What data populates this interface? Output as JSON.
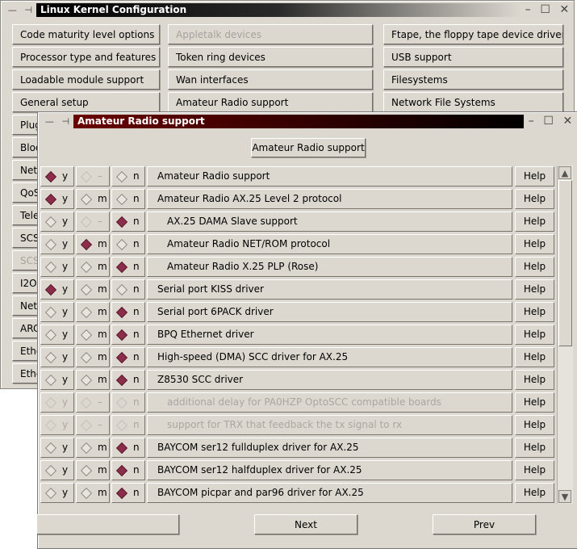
{
  "main_window": {
    "title": "Linux Kernel Configuration",
    "buttons_col1": [
      "Code maturity level options",
      "Processor type and features",
      "Loadable module support",
      "General setup",
      "Plug",
      "Bloc",
      "Netw",
      "QoS",
      "Tele",
      "SCS",
      "SCS",
      "I2O",
      "Netw",
      "ARC",
      "Ethe",
      "Ethe"
    ],
    "buttons_col2": [
      "Appletalk devices",
      "Token ring devices",
      "Wan interfaces",
      "Amateur Radio support"
    ],
    "buttons_col3": [
      "Ftape, the floppy tape device driver",
      "USB support",
      "Filesystems",
      "Network File Systems"
    ]
  },
  "child_window": {
    "title": "Amateur Radio support",
    "header_button": "Amateur Radio support",
    "option_labels": {
      "y": "y",
      "m": "m",
      "n": "n",
      "dash": "–"
    },
    "help_label": "Help",
    "rows": [
      {
        "label": "Amateur Radio support",
        "selected": "y",
        "m_dash": true,
        "indent": false,
        "disabled": false
      },
      {
        "label": "Amateur Radio AX.25 Level 2 protocol",
        "selected": "y",
        "m_dash": false,
        "indent": false,
        "disabled": false
      },
      {
        "label": "AX.25 DAMA Slave support",
        "selected": "n",
        "m_dash": true,
        "indent": true,
        "disabled": false
      },
      {
        "label": "Amateur Radio NET/ROM protocol",
        "selected": "m",
        "m_dash": false,
        "indent": true,
        "disabled": false
      },
      {
        "label": "Amateur Radio X.25 PLP (Rose)",
        "selected": "n",
        "m_dash": false,
        "indent": true,
        "disabled": false
      },
      {
        "label": "Serial port KISS driver",
        "selected": "y",
        "m_dash": false,
        "indent": false,
        "disabled": false
      },
      {
        "label": "Serial port 6PACK driver",
        "selected": "n",
        "m_dash": false,
        "indent": false,
        "disabled": false
      },
      {
        "label": "BPQ Ethernet driver",
        "selected": "n",
        "m_dash": false,
        "indent": false,
        "disabled": false
      },
      {
        "label": "High-speed (DMA) SCC driver for AX.25",
        "selected": "n",
        "m_dash": false,
        "indent": false,
        "disabled": false
      },
      {
        "label": "Z8530 SCC driver",
        "selected": "n",
        "m_dash": false,
        "indent": false,
        "disabled": false
      },
      {
        "label": "additional delay for PA0HZP OptoSCC compatible boards",
        "selected": "",
        "m_dash": true,
        "indent": true,
        "disabled": true
      },
      {
        "label": "support for TRX that feedback the tx signal to rx",
        "selected": "",
        "m_dash": true,
        "indent": true,
        "disabled": true
      },
      {
        "label": "BAYCOM ser12 fullduplex driver for AX.25",
        "selected": "n",
        "m_dash": false,
        "indent": false,
        "disabled": false
      },
      {
        "label": "BAYCOM ser12 halfduplex driver for AX.25",
        "selected": "n",
        "m_dash": false,
        "indent": false,
        "disabled": false
      },
      {
        "label": "BAYCOM picpar and par96 driver for AX.25",
        "selected": "n",
        "m_dash": false,
        "indent": false,
        "disabled": false
      }
    ],
    "footer": {
      "main_menu": "",
      "next": "Next",
      "prev": "Prev"
    }
  }
}
